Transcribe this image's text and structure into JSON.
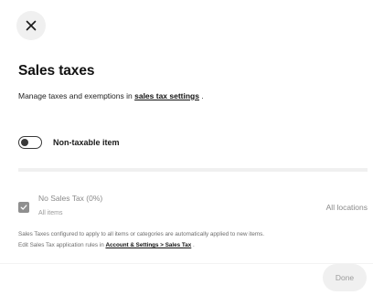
{
  "header": {
    "close_icon": "close-icon"
  },
  "title": "Sales taxes",
  "subtitle": {
    "prefix": "Manage taxes and exemptions in ",
    "link": "sales tax settings",
    "suffix": " ."
  },
  "non_taxable": {
    "label": "Non-taxable item",
    "enabled": false
  },
  "tax_items": [
    {
      "name": "No Sales Tax (0%)",
      "scope": "All items",
      "locations": "All locations",
      "checked": true
    }
  ],
  "note": {
    "line1": "Sales Taxes configured to apply to all items or categories are automatically applied to new items.",
    "line2_prefix": "Edit Sales Tax application rules in ",
    "line2_link": "Account & Settings > Sales Tax",
    "line2_suffix": " ."
  },
  "footer": {
    "done_label": "Done"
  },
  "colors": {
    "accent": "#111111",
    "muted_text": "#8a8a8a",
    "button_bg": "#f0f0f0"
  }
}
